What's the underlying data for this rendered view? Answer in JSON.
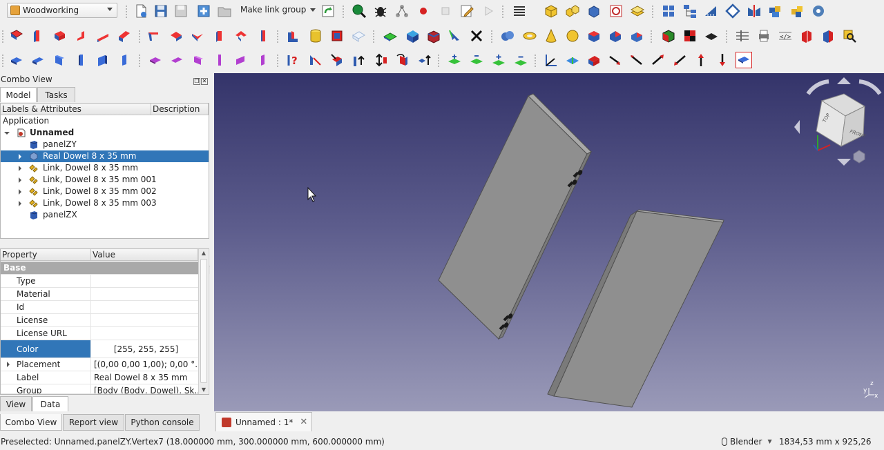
{
  "toolbar": {
    "workbench": "Woodworking",
    "make_link_group": "Make link group"
  },
  "combo_view": {
    "title": "Combo View",
    "tabs": [
      "Model",
      "Tasks"
    ],
    "tree_headers": [
      "Labels & Attributes",
      "Description"
    ],
    "tree": {
      "application": "Application",
      "document": "Unnamed",
      "items": [
        {
          "label": "panelZY",
          "icon": "panel-icon",
          "expandable": false,
          "selected": false
        },
        {
          "label": "Real Dowel 8 x 35 mm",
          "icon": "part-icon",
          "expandable": true,
          "selected": true
        },
        {
          "label": "Link, Dowel 8 x 35 mm",
          "icon": "link-icon",
          "expandable": true,
          "selected": false
        },
        {
          "label": "Link, Dowel 8 x 35 mm 001",
          "icon": "link-icon",
          "expandable": true,
          "selected": false
        },
        {
          "label": "Link, Dowel 8 x 35 mm 002",
          "icon": "link-icon",
          "expandable": true,
          "selected": false
        },
        {
          "label": "Link, Dowel 8 x 35 mm 003",
          "icon": "link-icon",
          "expandable": true,
          "selected": false
        },
        {
          "label": "panelZX",
          "icon": "panel-icon",
          "expandable": false,
          "selected": false
        }
      ]
    },
    "property_headers": [
      "Property",
      "Value"
    ],
    "properties": {
      "group": "Base",
      "rows": [
        {
          "name": "Type",
          "value": ""
        },
        {
          "name": "Material",
          "value": ""
        },
        {
          "name": "Id",
          "value": ""
        },
        {
          "name": "License",
          "value": ""
        },
        {
          "name": "License URL",
          "value": ""
        },
        {
          "name": "Color",
          "value": "[255, 255, 255]"
        },
        {
          "name": "Placement",
          "value": "[(0,00 0,00 1,00); 0,00 °..."
        },
        {
          "name": "Label",
          "value": "Real Dowel 8 x 35 mm"
        },
        {
          "name": "Group",
          "value": "[Body (Body, Dowel), Sk..."
        }
      ]
    },
    "prop_tabs": [
      "View",
      "Data"
    ]
  },
  "bottom_tabs": [
    "Combo View",
    "Report view",
    "Python console"
  ],
  "document_tab": {
    "label": "Unnamed : 1*"
  },
  "navcube": {
    "faces": [
      "FRONT",
      "TOP"
    ]
  },
  "status": {
    "preselected": "Preselected: Unnamed.panelZY.Vertex7 (18.000000 mm, 300.000000 mm, 600.000000 mm)",
    "navigation": "Blender",
    "dimensions": "1834,53 mm x 925,26 mm"
  },
  "colors": {
    "selection": "#3176b8",
    "panel_face": "#8f8f8f",
    "panel_edge": "#6a6a6a",
    "view_top": "#34346a",
    "view_bottom": "#9a9ab8"
  }
}
